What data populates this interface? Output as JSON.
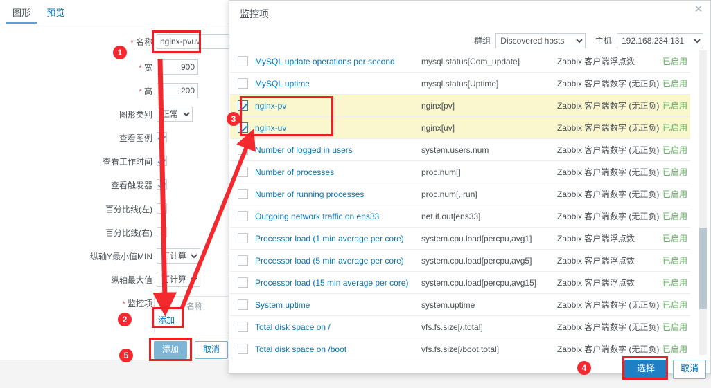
{
  "form": {
    "tabs": [
      {
        "label": "图形",
        "active": true
      },
      {
        "label": "预览",
        "active": false
      }
    ],
    "fields": {
      "name_label": "名称",
      "name_value": "nginx-pvuv",
      "width_label": "宽",
      "width_value": "900",
      "height_label": "高",
      "height_value": "200",
      "graph_type_label": "图形类别",
      "graph_type_value": "正常",
      "show_legend_label": "查看图例",
      "show_working_time_label": "查看工作时间",
      "show_triggers_label": "查看触发器",
      "percentile_left_label": "百分比线(左)",
      "percentile_right_label": "百分比线(右)",
      "ymin_label": "纵轴Y最小值MIN",
      "ymin_value": "可计算的",
      "ymax_label": "纵轴最大值",
      "ymax_value": "可计算的",
      "items_label": "监控项",
      "items_col_name": "名称",
      "items_add_link": "添加"
    },
    "buttons": {
      "submit": "添加",
      "cancel": "取消"
    }
  },
  "modal": {
    "title": "监控项",
    "close_icon": "close-icon",
    "filters": {
      "group_label": "群组",
      "group_value": "Discovered hosts",
      "host_label": "主机",
      "host_value": "192.168.234.131"
    },
    "rows": [
      {
        "name": "MySQL update operations per second",
        "key": "mysql.status[Com_update]",
        "type": "Zabbix 客户端",
        "vtype": "浮点数",
        "status": "已启用",
        "checked": false,
        "highlight": false
      },
      {
        "name": "MySQL uptime",
        "key": "mysql.status[Uptime]",
        "type": "Zabbix 客户端",
        "vtype": "数字 (无正负)",
        "status": "已启用",
        "checked": false,
        "highlight": false
      },
      {
        "name": "nginx-pv",
        "key": "nginx[pv]",
        "type": "Zabbix 客户端",
        "vtype": "数字 (无正负)",
        "status": "已启用",
        "checked": true,
        "highlight": true
      },
      {
        "name": "nginx-uv",
        "key": "nginx[uv]",
        "type": "Zabbix 客户端",
        "vtype": "数字 (无正负)",
        "status": "已启用",
        "checked": true,
        "highlight": true
      },
      {
        "name": "Number of logged in users",
        "key": "system.users.num",
        "type": "Zabbix 客户端",
        "vtype": "数字 (无正负)",
        "status": "已启用",
        "checked": false,
        "highlight": false
      },
      {
        "name": "Number of processes",
        "key": "proc.num[]",
        "type": "Zabbix 客户端",
        "vtype": "数字 (无正负)",
        "status": "已启用",
        "checked": false,
        "highlight": false
      },
      {
        "name": "Number of running processes",
        "key": "proc.num[,,run]",
        "type": "Zabbix 客户端",
        "vtype": "数字 (无正负)",
        "status": "已启用",
        "checked": false,
        "highlight": false
      },
      {
        "name": "Outgoing network traffic on ens33",
        "key": "net.if.out[ens33]",
        "type": "Zabbix 客户端",
        "vtype": "数字 (无正负)",
        "status": "已启用",
        "checked": false,
        "highlight": false
      },
      {
        "name": "Processor load (1 min average per core)",
        "key": "system.cpu.load[percpu,avg1]",
        "type": "Zabbix 客户端",
        "vtype": "浮点数",
        "status": "已启用",
        "checked": false,
        "highlight": false
      },
      {
        "name": "Processor load (5 min average per core)",
        "key": "system.cpu.load[percpu,avg5]",
        "type": "Zabbix 客户端",
        "vtype": "浮点数",
        "status": "已启用",
        "checked": false,
        "highlight": false
      },
      {
        "name": "Processor load (15 min average per core)",
        "key": "system.cpu.load[percpu,avg15]",
        "type": "Zabbix 客户端",
        "vtype": "浮点数",
        "status": "已启用",
        "checked": false,
        "highlight": false
      },
      {
        "name": "System uptime",
        "key": "system.uptime",
        "type": "Zabbix 客户端",
        "vtype": "数字 (无正负)",
        "status": "已启用",
        "checked": false,
        "highlight": false
      },
      {
        "name": "Total disk space on /",
        "key": "vfs.fs.size[/,total]",
        "type": "Zabbix 客户端",
        "vtype": "数字 (无正负)",
        "status": "已启用",
        "checked": false,
        "highlight": false
      },
      {
        "name": "Total disk space on /boot",
        "key": "vfs.fs.size[/boot,total]",
        "type": "Zabbix 客户端",
        "vtype": "数字 (无正负)",
        "status": "已启用",
        "checked": false,
        "highlight": false
      }
    ],
    "buttons": {
      "select": "选择",
      "cancel": "取消"
    }
  },
  "annotations": {
    "badges": [
      {
        "label": "1"
      },
      {
        "label": "2"
      },
      {
        "label": "3"
      },
      {
        "label": "4"
      },
      {
        "label": "5"
      }
    ],
    "accent_color": "#ec2024"
  }
}
